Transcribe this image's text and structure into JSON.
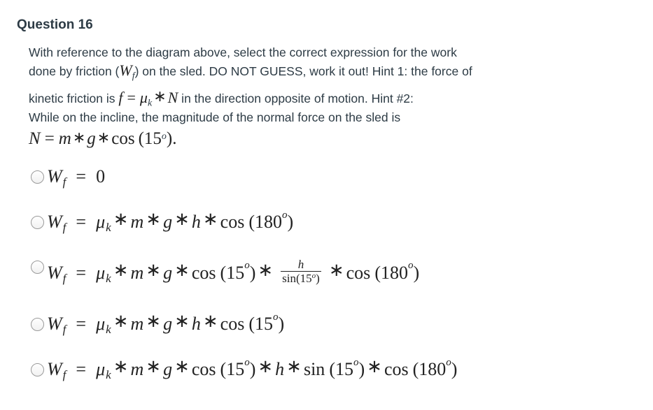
{
  "question": {
    "title": "Question 16",
    "text_lines": [
      "With reference to the diagram above, select the correct expression for the work",
      "done by friction (",
      ") on the sled. DO NOT GUESS, work it out! Hint 1: the force of",
      "kinetic friction is ",
      " in the direction opposite of motion. Hint #2:",
      "While on the incline, the magnitude of the normal force on the sled is"
    ],
    "inline_math": {
      "work_symbol": "W",
      "work_sub": "f",
      "friction_lhs": "f",
      "mu": "μ",
      "mu_sub": "k",
      "normal": "N",
      "normal_eq": {
        "lhs": "N",
        "m": "m",
        "g": "g",
        "cos": "cos",
        "angle": "15",
        "deg": "o",
        "end": "."
      }
    }
  },
  "answers": [
    {
      "id": "a",
      "selected": false,
      "expression": "W_f = 0"
    },
    {
      "id": "b",
      "selected": false,
      "expression": "W_f = μ_k * m * g * h * cos(180°)"
    },
    {
      "id": "c",
      "selected": false,
      "expression": "W_f = μ_k * m * g * cos(15°) * h/sin(15°) * cos(180°)"
    },
    {
      "id": "d",
      "selected": false,
      "expression": "W_f = μ_k * m * g * h * cos(15°)"
    },
    {
      "id": "e",
      "selected": false,
      "expression": "W_f = μ_k * m * g * cos(15°) * h * sin(15°) * cos(180°)"
    }
  ],
  "sym": {
    "W": "W",
    "f": "f",
    "eq": "=",
    "zero": "0",
    "mu": "μ",
    "k": "k",
    "ast": "∗",
    "m": "m",
    "g": "g",
    "h": "h",
    "cos": "cos",
    "sin": "sin",
    "lp": "(",
    "rp": ")",
    "a15": "15",
    "a180": "180",
    "deg": "o",
    "sin15": "sin(15"
  }
}
